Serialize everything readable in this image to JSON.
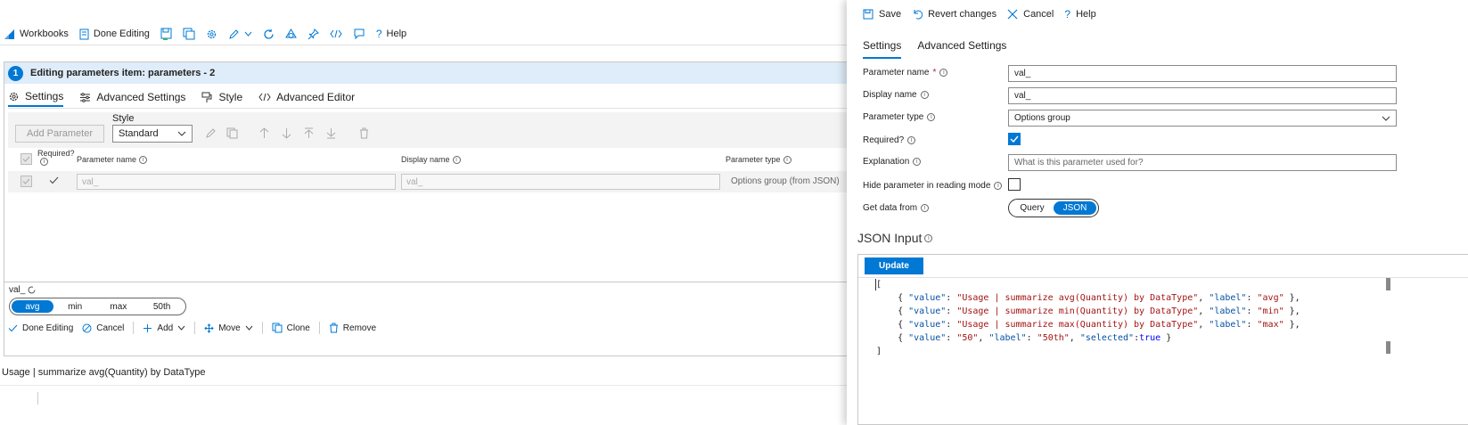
{
  "toolbar": {
    "workbooks": "Workbooks",
    "done_editing": "Done Editing",
    "help": "Help"
  },
  "editor": {
    "step": "1",
    "title": "Editing parameters item: parameters - 2",
    "tabs": [
      "Settings",
      "Advanced Settings",
      "Style",
      "Advanced Editor"
    ],
    "add_parameter": "Add Parameter",
    "style_label": "Style",
    "style_value": "Standard",
    "columns": {
      "required": "Required?",
      "parameter_name": "Parameter name",
      "display_name": "Display name",
      "parameter_type": "Parameter type"
    },
    "row": {
      "parameter_name": "val_",
      "display_name": "val_",
      "parameter_type": "Options group (from JSON)"
    },
    "preview_label": "val_",
    "options": [
      "avg",
      "min",
      "max",
      "50th"
    ],
    "selected_option": "avg",
    "actions": {
      "done_editing": "Done Editing",
      "cancel": "Cancel",
      "add": "Add",
      "move": "Move",
      "clone": "Clone",
      "remove": "Remove"
    }
  },
  "query_text": "Usage | summarize avg(Quantity) by DataType",
  "right_pane": {
    "toolbar": {
      "save": "Save",
      "revert": "Revert changes",
      "cancel": "Cancel",
      "help": "Help"
    },
    "tabs": [
      "Settings",
      "Advanced Settings"
    ],
    "fields": {
      "parameter_name_label": "Parameter name",
      "parameter_name_value": "val_",
      "display_name_label": "Display name",
      "display_name_value": "val_",
      "parameter_type_label": "Parameter type",
      "parameter_type_value": "Options group",
      "required_label": "Required?",
      "required_checked": true,
      "explanation_label": "Explanation",
      "explanation_placeholder": "What is this parameter used for?",
      "hide_label": "Hide parameter in reading mode",
      "hide_checked": false,
      "get_data_label": "Get data from",
      "source_options": [
        "Query",
        "JSON"
      ],
      "source_selected": "JSON"
    },
    "json_title": "JSON Input",
    "update_button": "Update",
    "json_lines": [
      {
        "value": "Usage | summarize avg(Quantity) by DataType",
        "label": "avg"
      },
      {
        "value": "Usage | summarize min(Quantity) by DataType",
        "label": "min"
      },
      {
        "value": "Usage | summarize max(Quantity) by DataType",
        "label": "max"
      },
      {
        "value": "50",
        "label": "50th",
        "selected": "true"
      }
    ]
  },
  "colors": {
    "accent": "#0078d4",
    "header_bg": "#dfecf9",
    "required": "#a4262c"
  }
}
